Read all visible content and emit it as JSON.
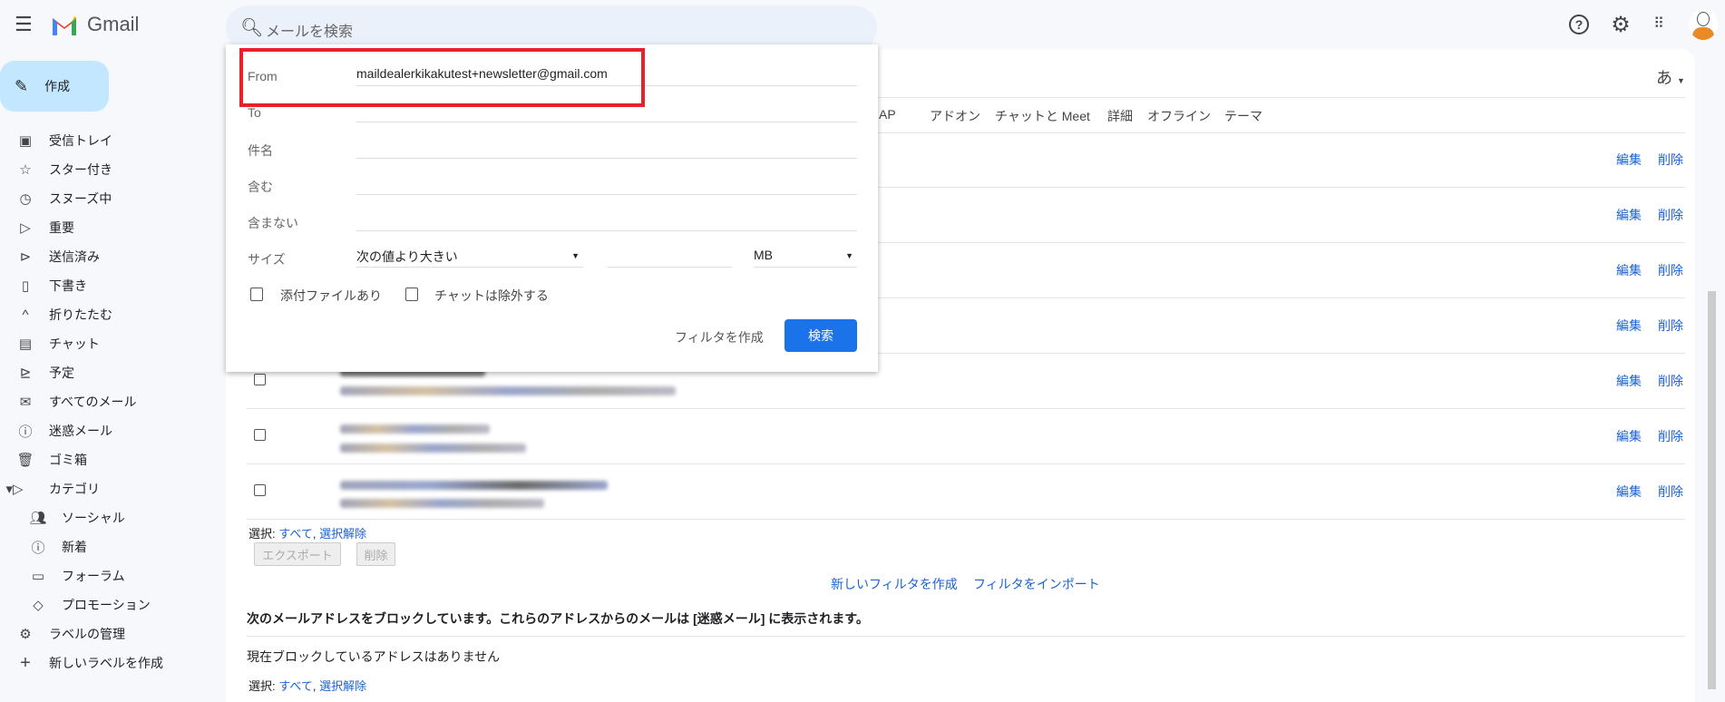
{
  "app": {
    "name": "Gmail",
    "search_placeholder": "メールを検索",
    "avatar": "avatar-icon"
  },
  "colors": {
    "accent": "#1a73e8",
    "link": "#1a62d6",
    "highlight": "#e8202a",
    "compose": "#c2e7ff"
  },
  "sidebar": {
    "compose": "作成",
    "items": [
      {
        "label": "受信トレイ",
        "icon": "inbox-icon"
      },
      {
        "label": "スター付き",
        "icon": "star-icon"
      },
      {
        "label": "スヌーズ中",
        "icon": "clock-icon"
      },
      {
        "label": "重要",
        "icon": "important-icon"
      },
      {
        "label": "送信済み",
        "icon": "send-icon"
      },
      {
        "label": "下書き",
        "icon": "draft-icon"
      },
      {
        "label": "折りたたむ",
        "icon": "chevron-up-icon"
      },
      {
        "label": "チャット",
        "icon": "chat-icon"
      },
      {
        "label": "予定",
        "icon": "scheduled-icon"
      },
      {
        "label": "すべてのメール",
        "icon": "all-mail-icon"
      },
      {
        "label": "迷惑メール",
        "icon": "spam-icon"
      },
      {
        "label": "ゴミ箱",
        "icon": "trash-icon"
      },
      {
        "label": "カテゴリ",
        "icon": "label-icon"
      }
    ],
    "categories": [
      {
        "label": "ソーシャル",
        "icon": "people-icon"
      },
      {
        "label": "新着",
        "icon": "info-icon"
      },
      {
        "label": "フォーラム",
        "icon": "forum-icon"
      },
      {
        "label": "プロモーション",
        "icon": "tag-icon"
      }
    ],
    "bottom": [
      {
        "label": "ラベルの管理",
        "icon": "gear-icon"
      },
      {
        "label": "新しいラベルを作成",
        "icon": "plus-icon"
      }
    ]
  },
  "settings": {
    "input_tool": "あ",
    "tabs": [
      "POP/IMAP",
      "アドオン",
      "チャットと Meet",
      "詳細",
      "オフライン",
      "テーマ"
    ],
    "row_actions": {
      "edit": "編集",
      "delete": "削除"
    },
    "select_label": "選択:",
    "select_all": "すべて",
    "select_none": "選択解除",
    "export": "エクスポート",
    "delete": "削除",
    "new_filter": "新しいフィルタを作成",
    "import_filter": "フィルタをインポート",
    "blocked_header": "次のメールアドレスをブロックしています。これらのアドレスからのメールは [迷惑メール] に表示されます。",
    "blocked_none": "現在ブロックしているアドレスはありません"
  },
  "search_dialog": {
    "from_label": "From",
    "from_value": "maildealerkikakutest+newsletter@gmail.com",
    "to_label": "To",
    "subject_label": "件名",
    "has_label": "含む",
    "not_label": "含まない",
    "size_label": "サイズ",
    "size_op": "次の値より大きい",
    "size_unit": "MB",
    "has_attachment": "添付ファイルあり",
    "exclude_chats": "チャットは除外する",
    "create_filter": "フィルタを作成",
    "search": "検索",
    "has_attachment_checked": false,
    "exclude_chats_checked": false
  }
}
